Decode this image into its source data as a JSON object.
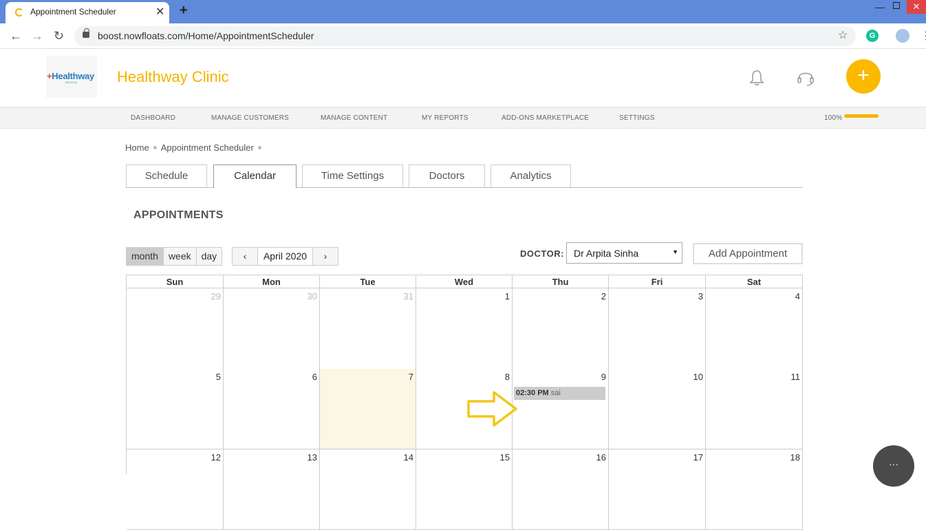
{
  "browser": {
    "tab_title": "Appointment Scheduler",
    "tab_close": "✕",
    "new_tab": "+",
    "url": "boost.nowfloats.com/Home/AppointmentScheduler",
    "back": "←",
    "forward": "→",
    "reload": "↻",
    "star": "☆",
    "ext_label": "G",
    "menu": "⋮",
    "minimize": "—",
    "close": "✕"
  },
  "header": {
    "logo_plus": "+",
    "logo_text": "Healthway",
    "logo_sub": "MEDICAL",
    "clinic_name": "Healthway Clinic",
    "fab_label": "+"
  },
  "nav": {
    "items": [
      "DASHBOARD",
      "MANAGE CUSTOMERS",
      "MANAGE CONTENT",
      "MY REPORTS",
      "ADD-ONS MARKETPLACE",
      "SETTINGS"
    ],
    "progress_label": "100%",
    "progress": 1.0
  },
  "breadcrumb": {
    "home": "Home",
    "current": "Appointment Scheduler"
  },
  "tabs": [
    "Schedule",
    "Calendar",
    "Time Settings",
    "Doctors",
    "Analytics"
  ],
  "active_tab": "Calendar",
  "appointments_title": "APPOINTMENTS",
  "controls": {
    "views": [
      "month",
      "week",
      "day"
    ],
    "active_view": "month",
    "prev": "‹",
    "next": "›",
    "month_label": "April 2020",
    "doctor_label": "DOCTOR:",
    "doctor_value": "Dr Arpita Sinha",
    "doctor_caret": "▼",
    "add_button": "Add Appointment"
  },
  "calendar": {
    "days_of_week": [
      "Sun",
      "Mon",
      "Tue",
      "Wed",
      "Thu",
      "Fri",
      "Sat"
    ],
    "weeks": [
      [
        "29",
        "30",
        "31",
        "1",
        "2",
        "3",
        "4"
      ],
      [
        "5",
        "6",
        "7",
        "8",
        "9",
        "10",
        "11"
      ],
      [
        "12",
        "13",
        "14",
        "15",
        "16",
        "17",
        "18"
      ]
    ],
    "other_month_days": [
      "29",
      "30",
      "31"
    ],
    "today": "7",
    "event": {
      "time": "02:30 PM",
      "name": "sai",
      "day": "9"
    }
  },
  "chat_label": "···",
  "colors": {
    "brand": "#f5b400",
    "titlebar": "#5f89d9",
    "today": "#fcf7e3",
    "event": "#cccccc"
  }
}
